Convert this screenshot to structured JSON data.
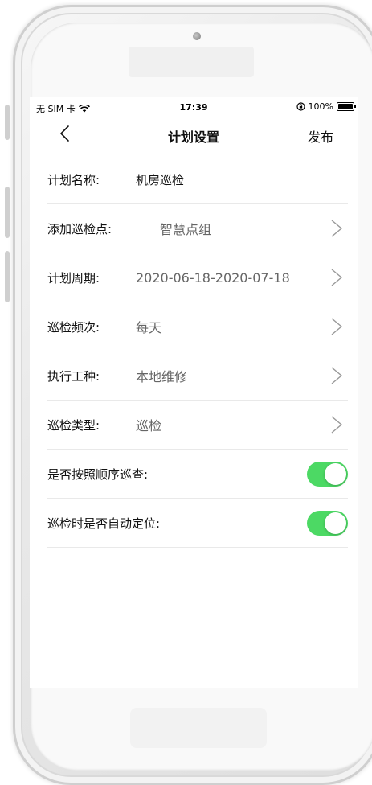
{
  "status_bar": {
    "carrier": "无 SIM 卡",
    "wifi_icon": "wifi-icon",
    "time": "17:39",
    "lock_icon": "orientation-lock-icon",
    "battery_text": "100%",
    "battery_icon": "battery-icon"
  },
  "nav": {
    "back_icon": "chevron-left-icon",
    "title": "计划设置",
    "publish_label": "发布"
  },
  "form": {
    "plan_name": {
      "label": "计划名称:",
      "value": "机房巡检"
    },
    "add_point": {
      "label": "添加巡检点:",
      "value": "智慧点组"
    },
    "plan_period": {
      "label": "计划周期:",
      "value": "2020-06-18-2020-07-18"
    },
    "frequency": {
      "label": "巡检频次:",
      "value": "每天"
    },
    "work_type": {
      "label": "执行工种:",
      "value": "本地维修"
    },
    "inspect_type": {
      "label": "巡检类型:",
      "value": "巡检"
    },
    "in_order": {
      "label": "是否按照顺序巡查:",
      "enabled": true
    },
    "auto_locate": {
      "label": "巡检时是否自动定位:",
      "enabled": true
    }
  },
  "colors": {
    "toggle_on": "#4cd964",
    "divider": "#e9e9e9",
    "value_text": "#666666"
  }
}
